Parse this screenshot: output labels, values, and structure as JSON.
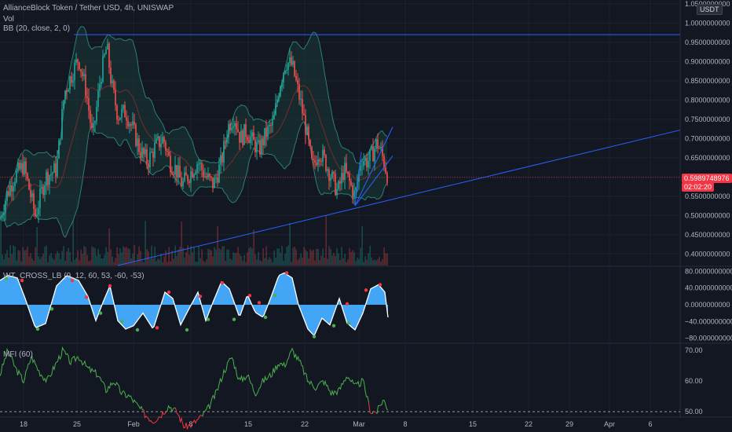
{
  "header": {
    "symbol_line": "AllianceBlock Token / Tether USD, 4h, UNISWAP",
    "vol_label": "Vol",
    "bb_label": "BB (20, close, 2, 0)",
    "currency_badge": "USDT"
  },
  "price_badge": {
    "price": "0.5989748976",
    "countdown": "02:02:20"
  },
  "panes": {
    "wt_label": "WT_CROSS_LB (9, 12, 60, 53, -60, -53)",
    "mfi_label": "MFI (60)"
  },
  "colors": {
    "background": "#131722",
    "up": "#26a69a",
    "down": "#ef5350",
    "trendline": "#2962ff",
    "bb_fill": "#1a3a38",
    "bb_band": "#2a7f74",
    "bb_basis": "#7a2a2a",
    "wt_fill": "#42a5f5",
    "wt_line": "#ffffff",
    "mfi_line": "#4caf50",
    "mfi_below": "#f23645",
    "price_badge_bg": "#f23645",
    "grid": "#1e222d",
    "axis_text": "#b2b5be"
  },
  "chart_data": [
    {
      "type": "candlestick",
      "pane": "price",
      "title": "AllianceBlock Token / Tether USD, 4h, UNISWAP",
      "ytick_labels": [
        "1.0500000000",
        "1.0000000000",
        "0.9500000000",
        "0.9000000000",
        "0.8500000000",
        "0.8000000000",
        "0.7500000000",
        "0.7000000000",
        "0.6500000000",
        "0.6000000000",
        "0.5500000000",
        "0.5000000000",
        "0.4500000000",
        "0.4000000000"
      ],
      "ylim": [
        0.37,
        1.06
      ],
      "xtick_labels": [
        "18",
        "25",
        "Feb",
        "8",
        "15",
        "22",
        "Mar",
        "8",
        "15",
        "22",
        "29",
        "Apr",
        "6"
      ],
      "last_price": 0.5989748976,
      "price_waypoints": [
        [
          0,
          0.49
        ],
        [
          8,
          0.55
        ],
        [
          18,
          0.6
        ],
        [
          30,
          0.63
        ],
        [
          45,
          0.5
        ],
        [
          58,
          0.6
        ],
        [
          72,
          0.62
        ],
        [
          82,
          0.82
        ],
        [
          90,
          0.86
        ],
        [
          100,
          0.91
        ],
        [
          110,
          0.82
        ],
        [
          118,
          0.7
        ],
        [
          128,
          0.86
        ],
        [
          136,
          0.94
        ],
        [
          142,
          0.84
        ],
        [
          150,
          0.76
        ],
        [
          160,
          0.77
        ],
        [
          170,
          0.72
        ],
        [
          178,
          0.67
        ],
        [
          188,
          0.64
        ],
        [
          198,
          0.68
        ],
        [
          208,
          0.7
        ],
        [
          216,
          0.64
        ],
        [
          224,
          0.62
        ],
        [
          232,
          0.58
        ],
        [
          242,
          0.61
        ],
        [
          252,
          0.64
        ],
        [
          262,
          0.6
        ],
        [
          272,
          0.58
        ],
        [
          282,
          0.64
        ],
        [
          290,
          0.73
        ],
        [
          298,
          0.76
        ],
        [
          306,
          0.7
        ],
        [
          314,
          0.72
        ],
        [
          322,
          0.69
        ],
        [
          330,
          0.67
        ],
        [
          338,
          0.71
        ],
        [
          348,
          0.74
        ],
        [
          356,
          0.84
        ],
        [
          364,
          0.9
        ],
        [
          372,
          0.89
        ],
        [
          382,
          0.8
        ],
        [
          390,
          0.72
        ],
        [
          398,
          0.62
        ],
        [
          406,
          0.67
        ],
        [
          414,
          0.64
        ],
        [
          422,
          0.6
        ],
        [
          430,
          0.56
        ],
        [
          438,
          0.62
        ],
        [
          446,
          0.58
        ],
        [
          452,
          0.55
        ],
        [
          460,
          0.65
        ],
        [
          468,
          0.64
        ],
        [
          474,
          0.66
        ],
        [
          480,
          0.69
        ],
        [
          486,
          0.66
        ],
        [
          490,
          0.63
        ],
        [
          494,
          0.6
        ]
      ],
      "series": [
        {
          "name": "Vol",
          "type": "bar"
        },
        {
          "name": "BB (20, close, 2, 0)",
          "type": "band"
        }
      ]
    },
    {
      "type": "area",
      "pane": "oscillator",
      "title": "WT_CROSS_LB (9, 12, 60, 53, -60, -53)",
      "ytick_labels": [
        "80.0000000000",
        "40.0000000000",
        "0.0000000000",
        "−40.0000000000",
        "−80.0000000000"
      ],
      "ylim": [
        -90,
        90
      ],
      "x": [
        0,
        10,
        22,
        32,
        45,
        58,
        72,
        85,
        100,
        112,
        122,
        132,
        140,
        150,
        160,
        170,
        182,
        195,
        210,
        220,
        230,
        240,
        252,
        262,
        272,
        282,
        292,
        305,
        315,
        325,
        335,
        345,
        355,
        362,
        372,
        380,
        392,
        400,
        410,
        420,
        432,
        442,
        452,
        462,
        472,
        482,
        490,
        494
      ],
      "values": [
        58,
        70,
        64,
        15,
        -55,
        -45,
        45,
        70,
        58,
        20,
        -38,
        10,
        45,
        -38,
        -58,
        -50,
        -20,
        -58,
        30,
        15,
        -48,
        -12,
        30,
        -38,
        10,
        55,
        38,
        -30,
        24,
        -18,
        -30,
        18,
        70,
        76,
        64,
        0,
        -58,
        -74,
        -32,
        -48,
        15,
        -44,
        -60,
        -20,
        38,
        48,
        30,
        -30
      ],
      "cross_markers": [
        {
          "x": 8,
          "y": 62,
          "color": "#4caf50"
        },
        {
          "x": 28,
          "y": 58,
          "color": "#f23645"
        },
        {
          "x": 48,
          "y": -58,
          "color": "#4caf50"
        },
        {
          "x": 66,
          "y": -10,
          "color": "#4caf50"
        },
        {
          "x": 92,
          "y": 58,
          "color": "#f23645"
        },
        {
          "x": 110,
          "y": 18,
          "color": "#f23645"
        },
        {
          "x": 128,
          "y": -20,
          "color": "#4caf50"
        },
        {
          "x": 140,
          "y": 45,
          "color": "#f23645"
        },
        {
          "x": 155,
          "y": -40,
          "color": "#4caf50"
        },
        {
          "x": 175,
          "y": -60,
          "color": "#4caf50"
        },
        {
          "x": 200,
          "y": -55,
          "color": "#f23645"
        },
        {
          "x": 215,
          "y": 30,
          "color": "#f23645"
        },
        {
          "x": 238,
          "y": -60,
          "color": "#4caf50"
        },
        {
          "x": 255,
          "y": 20,
          "color": "#f23645"
        },
        {
          "x": 265,
          "y": -35,
          "color": "#4caf50"
        },
        {
          "x": 283,
          "y": 52,
          "color": "#f23645"
        },
        {
          "x": 298,
          "y": -35,
          "color": "#4caf50"
        },
        {
          "x": 318,
          "y": 22,
          "color": "#f23645"
        },
        {
          "x": 330,
          "y": 5,
          "color": "#f23645"
        },
        {
          "x": 338,
          "y": -30,
          "color": "#4caf50"
        },
        {
          "x": 350,
          "y": 22,
          "color": "#4caf50"
        },
        {
          "x": 365,
          "y": 76,
          "color": "#f23645"
        },
        {
          "x": 400,
          "y": -76,
          "color": "#4caf50"
        },
        {
          "x": 425,
          "y": -50,
          "color": "#4caf50"
        },
        {
          "x": 444,
          "y": -44,
          "color": "#4caf50"
        },
        {
          "x": 442,
          "y": 2,
          "color": "#f23645"
        },
        {
          "x": 466,
          "y": 35,
          "color": "#f23645"
        },
        {
          "x": 484,
          "y": 48,
          "color": "#f23645"
        }
      ]
    },
    {
      "type": "line",
      "pane": "mfi",
      "title": "MFI (60)",
      "ytick_labels": [
        "70.00",
        "60.00",
        "50.00"
      ],
      "ylim": [
        48.5,
        72
      ],
      "reference_line": 50.0,
      "x": [
        0,
        10,
        20,
        30,
        40,
        50,
        60,
        70,
        80,
        90,
        100,
        112,
        125,
        135,
        145,
        155,
        165,
        175,
        185,
        195,
        205,
        215,
        225,
        235,
        245,
        255,
        265,
        275,
        285,
        295,
        305,
        315,
        325,
        335,
        345,
        355,
        362,
        372,
        382,
        392,
        402,
        412,
        422,
        432,
        442,
        452,
        462,
        472,
        480,
        488,
        494
      ],
      "values": [
        62,
        70,
        64,
        60,
        68,
        63,
        60,
        65,
        70,
        66,
        68,
        64,
        62,
        57,
        60,
        56,
        55,
        52,
        49,
        47,
        49,
        52,
        50,
        45,
        46,
        48,
        51,
        56,
        63,
        68,
        60,
        62,
        56,
        60,
        62,
        66,
        65,
        70,
        66,
        60,
        58,
        60,
        56,
        57,
        62,
        58,
        60,
        50,
        50,
        54,
        51
      ]
    }
  ]
}
